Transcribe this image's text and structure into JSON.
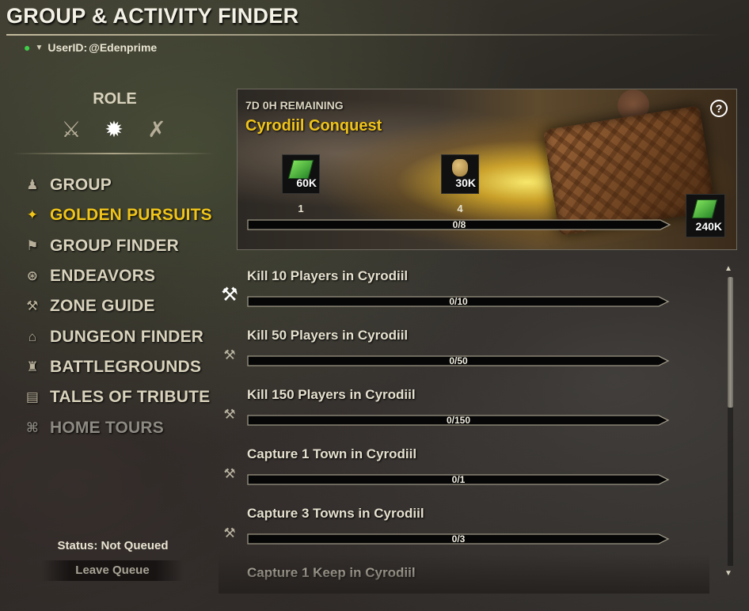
{
  "window": {
    "title": "GROUP & ACTIVITY FINDER"
  },
  "user": {
    "label": "UserID:",
    "id": "@Edenprime"
  },
  "role": {
    "label": "ROLE",
    "icons": [
      {
        "name": "tank-shield-sword-icon",
        "glyph": "⚔",
        "selected": false
      },
      {
        "name": "healer-burst-icon",
        "glyph": "✹",
        "selected": true
      },
      {
        "name": "damage-axes-icon",
        "glyph": "✗",
        "selected": false
      }
    ]
  },
  "nav": [
    {
      "label": "GROUP",
      "icon": "group-icon",
      "glyph": "♟",
      "state": "normal"
    },
    {
      "label": "GOLDEN PURSUITS",
      "icon": "golden-pursuits-icon",
      "glyph": "✦",
      "state": "active"
    },
    {
      "label": "GROUP FINDER",
      "icon": "group-finder-icon",
      "glyph": "⚑",
      "state": "normal"
    },
    {
      "label": "ENDEAVORS",
      "icon": "endeavors-icon",
      "glyph": "⊛",
      "state": "normal"
    },
    {
      "label": "ZONE GUIDE",
      "icon": "zone-guide-icon",
      "glyph": "⚒",
      "state": "normal"
    },
    {
      "label": "DUNGEON FINDER",
      "icon": "dungeon-finder-icon",
      "glyph": "⌂",
      "state": "normal"
    },
    {
      "label": "BATTLEGROUNDS",
      "icon": "battlegrounds-icon",
      "glyph": "♜",
      "state": "normal"
    },
    {
      "label": "TALES OF TRIBUTE",
      "icon": "tales-of-tribute-icon",
      "glyph": "▤",
      "state": "normal"
    },
    {
      "label": "HOME TOURS",
      "icon": "home-tours-icon",
      "glyph": "⌘",
      "state": "disabled"
    }
  ],
  "status": {
    "label": "Status:",
    "value": "Not Queued"
  },
  "leave_queue": {
    "label": "Leave Queue"
  },
  "banner": {
    "timer": "7D 0H REMAINING",
    "name": "Cyrodiil Conquest",
    "help_icon": "help-icon",
    "rewards": [
      {
        "amount": "60K",
        "type": "gem",
        "count": "1"
      },
      {
        "amount": "30K",
        "type": "bag",
        "count": "4"
      },
      {
        "amount": "240K",
        "type": "gem",
        "count": ""
      }
    ],
    "progress": {
      "label": "0/8",
      "value": 0
    }
  },
  "activities": [
    {
      "title": "Kill 10 Players in Cyrodiil",
      "progress": "0/10",
      "fraction": 0,
      "pinned": true
    },
    {
      "title": "Kill 50 Players in Cyrodiil",
      "progress": "0/50",
      "fraction": 0,
      "pinned": false
    },
    {
      "title": "Kill 150 Players in Cyrodiil",
      "progress": "0/150",
      "fraction": 0,
      "pinned": false
    },
    {
      "title": "Capture 1 Town in Cyrodiil",
      "progress": "0/1",
      "fraction": 0,
      "pinned": false
    },
    {
      "title": "Capture 3 Towns in Cyrodiil",
      "progress": "0/3",
      "fraction": 0,
      "pinned": false
    },
    {
      "title": "Capture 1 Keep in Cyrodiil",
      "progress": "",
      "fraction": 0,
      "pinned": false
    }
  ],
  "colors": {
    "accent": "#f0c419",
    "text": "#e6e1cf",
    "disabled": "#8d8a82",
    "online": "#3fd04a"
  }
}
